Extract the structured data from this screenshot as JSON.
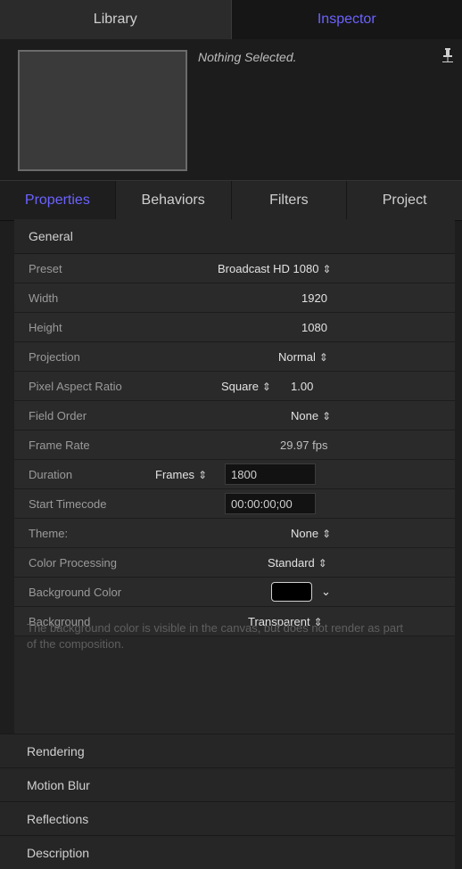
{
  "top_tabs": {
    "library": "Library",
    "inspector": "Inspector"
  },
  "header": {
    "nothing_selected": "Nothing Selected."
  },
  "sub_tabs": [
    "Properties",
    "Behaviors",
    "Filters",
    "Project"
  ],
  "general": {
    "title": "General",
    "preset": {
      "label": "Preset",
      "value": "Broadcast HD 1080"
    },
    "width": {
      "label": "Width",
      "value": "1920"
    },
    "height": {
      "label": "Height",
      "value": "1080"
    },
    "projection": {
      "label": "Projection",
      "value": "Normal"
    },
    "pixel_aspect": {
      "label": "Pixel Aspect Ratio",
      "value": "Square",
      "number": "1.00"
    },
    "field_order": {
      "label": "Field Order",
      "value": "None"
    },
    "frame_rate": {
      "label": "Frame Rate",
      "value": "29.97 fps"
    },
    "duration": {
      "label": "Duration",
      "unit": "Frames",
      "value": "1800"
    },
    "start_timecode": {
      "label": "Start Timecode",
      "value": "00:00:00;00"
    },
    "theme": {
      "label": "Theme:",
      "value": "None"
    },
    "color_processing": {
      "label": "Color Processing",
      "value": "Standard"
    },
    "background_color": {
      "label": "Background Color",
      "color": "#000000"
    },
    "background": {
      "label": "Background",
      "value": "Transparent"
    },
    "description": "The background color is visible in the canvas, but does not render as part of the composition."
  },
  "sections": [
    "Rendering",
    "Motion Blur",
    "Reflections",
    "Description"
  ],
  "colors": {
    "accent": "#6b63ff"
  }
}
